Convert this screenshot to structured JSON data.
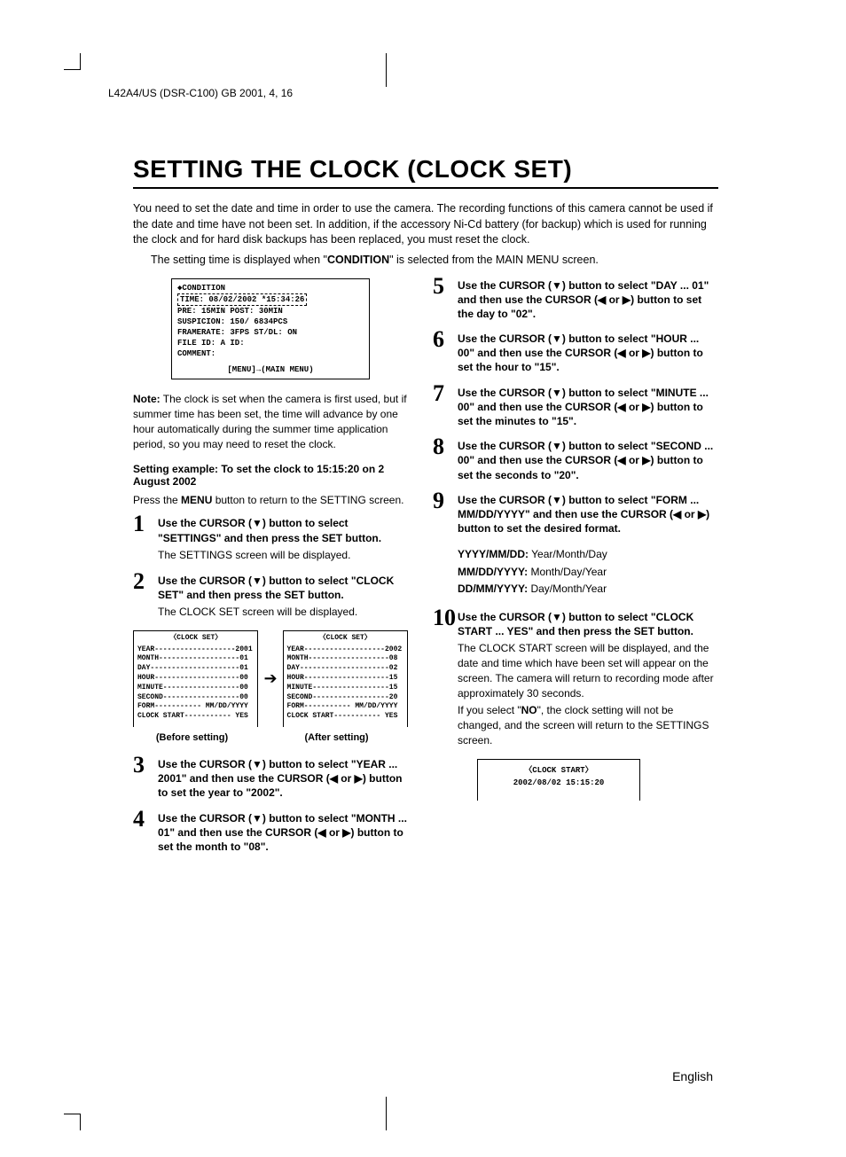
{
  "header": "L42A4/US (DSR-C100)   GB   2001, 4, 16",
  "title": "SETTING THE CLOCK (CLOCK SET)",
  "intro1": "You need to set the date and time in order to use the camera. The recording functions of this camera cannot be used if the date and time have not been set. In addition, if the accessory Ni-Cd battery (for backup) which is used for running the clock and for hard disk backups has been replaced, you must reset the clock.",
  "intro2_pre": "The setting time is displayed when \"",
  "intro2_b": "CONDITION",
  "intro2_post": "\" is selected from the MAIN MENU screen.",
  "osd": {
    "l1": "◆CONDITION",
    "l2": "TIME: 08/02/2002 *15:34:26",
    "l3": "PRE:  15MIN   POST:  30MIN",
    "l4": "SUSPICION:   150/  6834PCS",
    "l5": "FRAMERATE: 3FPS  ST/DL: ON",
    "l6": "FILE ID: A        ID:",
    "l7": "COMMENT:",
    "foot": "[MENU]→(MAIN MENU)"
  },
  "note_lbl": "Note:",
  "note_txt": " The clock is set when the camera is first used, but if summer time has been set, the time will advance by one hour automatically during the summer time application period, so you may need to reset the clock.",
  "example_head": "Setting example:   To set the clock to 15:15:20 on 2 August 2002",
  "press_pre": "Press the ",
  "press_b": "MENU",
  "press_post": " button to return to the SETTING screen.",
  "steps": {
    "s1": {
      "n": "1",
      "t": "Use the CURSOR (▼) button to select \"SETTINGS\" and then press the SET button.",
      "b": "The SETTINGS screen will be displayed."
    },
    "s2": {
      "n": "2",
      "t": "Use the CURSOR (▼) button to select \"CLOCK SET\" and then press the SET button.",
      "b": "The CLOCK SET screen will be displayed."
    },
    "s3": {
      "n": "3",
      "t": "Use the CURSOR (▼) button to select \"YEAR ... 2001\" and then use the CURSOR (◀ or ▶) button to set the year to \"2002\"."
    },
    "s4": {
      "n": "4",
      "t": "Use the CURSOR (▼) button to select \"MONTH ... 01\" and then use the CURSOR (◀ or ▶) button to set the month to \"08\"."
    },
    "s5": {
      "n": "5",
      "t": "Use the CURSOR (▼) button to select \"DAY ... 01\" and then use the CURSOR (◀ or ▶) button to set the day to \"02\"."
    },
    "s6": {
      "n": "6",
      "t": "Use the CURSOR (▼) button to select \"HOUR ... 00\" and then use the CURSOR (◀ or ▶) button to set the hour to \"15\"."
    },
    "s7": {
      "n": "7",
      "t": "Use the CURSOR (▼) button to select \"MINUTE ... 00\" and then use the CURSOR (◀ or ▶) button to set the minutes to \"15\"."
    },
    "s8": {
      "n": "8",
      "t": "Use the CURSOR (▼) button to select \"SECOND ... 00\" and then use the CURSOR (◀ or ▶) button to set the seconds to \"20\"."
    },
    "s9": {
      "n": "9",
      "t": "Use the CURSOR (▼) button to select \"FORM ... MM/DD/YYYY\" and then use the CURSOR (◀ or ▶) button to set the desired format."
    },
    "s10": {
      "n": "10",
      "t": "Use the CURSOR (▼) button to select \"CLOCK START ... YES\" and then press the SET button.",
      "b1": "The CLOCK START screen will be displayed, and the date and time which have been set will appear on the screen. The camera will return to recording mode after approximately 30 seconds.",
      "b2_pre": "If you select \"",
      "b2_b": "NO",
      "b2_post": "\", the clock setting will not be changed, and the screen will return to the SETTINGS screen."
    }
  },
  "formats": {
    "y_b": "YYYY/MM/DD:",
    "y": " Year/Month/Day",
    "m_b": "MM/DD/YYYY:",
    "m": " Month/Day/Year",
    "d_b": "DD/MM/YYYY:",
    "d": " Day/Month/Year"
  },
  "clockset": {
    "hd": "〈CLOCK SET〉",
    "before": [
      "YEAR-------------------2001",
      "MONTH-------------------01",
      "DAY---------------------01",
      "HOUR--------------------00",
      "MINUTE------------------00",
      "SECOND------------------00",
      "FORM----------- MM/DD/YYYY",
      "CLOCK START----------- YES"
    ],
    "after": [
      "YEAR-------------------2002",
      "MONTH-------------------08",
      "DAY---------------------02",
      "HOUR--------------------15",
      "MINUTE------------------15",
      "SECOND------------------20",
      "FORM----------- MM/DD/YYYY",
      "CLOCK START----------- YES"
    ],
    "cap_before": "(Before setting)",
    "cap_after": "(After setting)"
  },
  "clockstart": {
    "hd": "〈CLOCK START〉",
    "line": "2002/08/02 15:15:20"
  },
  "footer_lang": "English"
}
